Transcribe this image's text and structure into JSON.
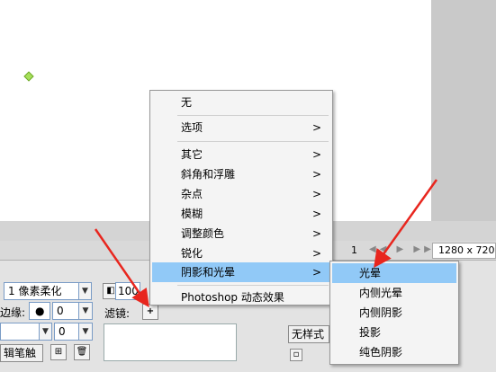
{
  "status": {
    "page": "1",
    "nav": "◀◀ ▶ ▶▶",
    "size": "1280 x 720"
  },
  "props": {
    "edge_value": "1 像素柔化",
    "edge_label": "边缘:",
    "edge_num": "0",
    "blend_num": "0",
    "opacity_value": "100",
    "filter_label": "滤镜:",
    "filter_add": "+",
    "edit_button": "辑笔触",
    "style_value": "无样式"
  },
  "menu": {
    "items": [
      {
        "label": "无"
      },
      {
        "label": "选项",
        "arrow": ">"
      },
      {
        "label": "其它",
        "arrow": ">"
      },
      {
        "label": "斜角和浮雕",
        "arrow": ">"
      },
      {
        "label": "杂点",
        "arrow": ">"
      },
      {
        "label": "模糊",
        "arrow": ">"
      },
      {
        "label": "调整颜色",
        "arrow": ">"
      },
      {
        "label": "锐化",
        "arrow": ">"
      },
      {
        "label": "阴影和光晕",
        "arrow": ">"
      },
      {
        "label": "Photoshop 动态效果"
      }
    ]
  },
  "submenu": {
    "items": [
      {
        "label": "光晕"
      },
      {
        "label": "内侧光晕"
      },
      {
        "label": "内侧阴影"
      },
      {
        "label": "投影"
      },
      {
        "label": "纯色阴影"
      }
    ]
  },
  "colors": {
    "highlight": "#91c9f7",
    "arrow": "#e8261e",
    "handle": "#a6e05a"
  }
}
